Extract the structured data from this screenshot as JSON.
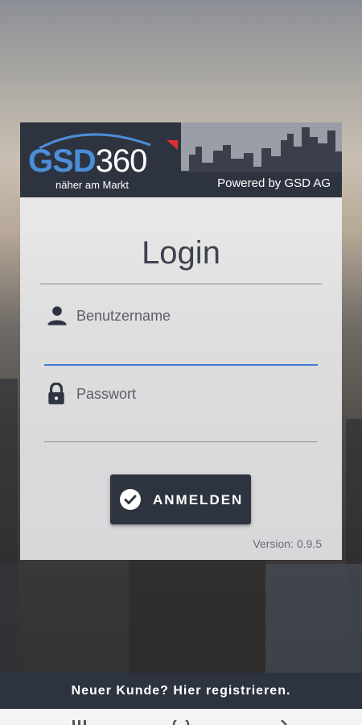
{
  "header": {
    "logo_gsd": "GSD",
    "logo_360": "360",
    "tagline": "näher am Markt",
    "powered_by": "Powered by GSD AG"
  },
  "form": {
    "title": "Login",
    "username_label": "Benutzername",
    "username_value": "",
    "password_label": "Passwort",
    "password_value": "",
    "submit_label": "ANMELDEN",
    "version": "Version: 0.9.5"
  },
  "footer": {
    "register_text": "Neuer Kunde? Hier registrieren."
  },
  "icons": {
    "username": "person-icon",
    "password": "lock-icon",
    "submit": "check-circle-icon"
  },
  "colors": {
    "primary_dark": "#2e3340",
    "accent_blue": "#4a8fd8",
    "focus_underline": "#3d7bd6",
    "logo_flag": "#d9312f"
  }
}
